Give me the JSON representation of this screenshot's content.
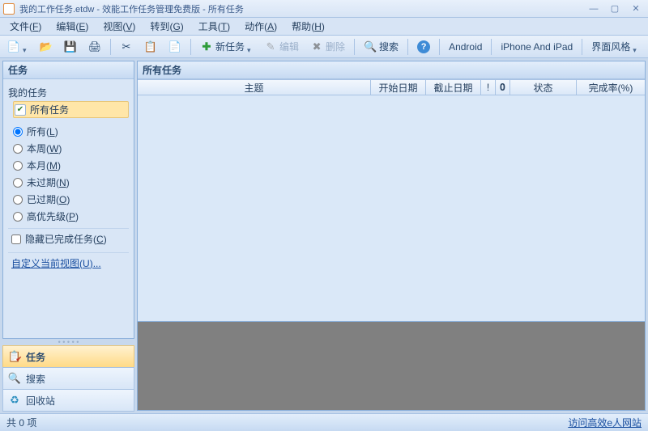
{
  "window": {
    "title": "我的工作任务.etdw - 效能工作任务管理免费版 - 所有任务"
  },
  "menu": {
    "file": {
      "label": "文件",
      "accel": "F"
    },
    "edit": {
      "label": "编辑",
      "accel": "E"
    },
    "view": {
      "label": "视图",
      "accel": "V"
    },
    "goto": {
      "label": "转到",
      "accel": "G"
    },
    "tools": {
      "label": "工具",
      "accel": "T"
    },
    "action": {
      "label": "动作",
      "accel": "A"
    },
    "help": {
      "label": "帮助",
      "accel": "H"
    }
  },
  "toolbar": {
    "new_task": "新任务",
    "edit": "编辑",
    "delete": "删除",
    "search": "搜索",
    "android": "Android",
    "iphone_ipad": "iPhone And iPad",
    "interface_style": "界面风格"
  },
  "sidebar": {
    "panel_title": "任务",
    "my_tasks": "我的任务",
    "all_tasks_node": "所有任务",
    "filters": {
      "all": {
        "label": "所有",
        "accel": "L",
        "selected": true
      },
      "week": {
        "label": "本周",
        "accel": "W",
        "selected": false
      },
      "month": {
        "label": "本月",
        "accel": "M",
        "selected": false
      },
      "not_overdue": {
        "label": "未过期",
        "accel": "N",
        "selected": false
      },
      "overdue": {
        "label": "已过期",
        "accel": "O",
        "selected": false
      },
      "high_pri": {
        "label": "高优先级",
        "accel": "P",
        "selected": false
      }
    },
    "hide_completed": {
      "label": "隐藏已完成任务",
      "accel": "C",
      "checked": false
    },
    "custom_view": {
      "label": "自定义当前视图",
      "accel": "U",
      "suffix": "..."
    },
    "shortcuts": {
      "tasks": "任务",
      "search": "搜索",
      "recycle": "回收站"
    }
  },
  "content": {
    "header": "所有任务",
    "columns": {
      "subject": "主题",
      "start_date": "开始日期",
      "end_date": "截止日期",
      "priority_mark": "!",
      "attachment_mark": "📎",
      "status": "状态",
      "percent": "完成率(%)"
    }
  },
  "status": {
    "count_label": "共 0 项",
    "link": "访问高效e人网站"
  }
}
